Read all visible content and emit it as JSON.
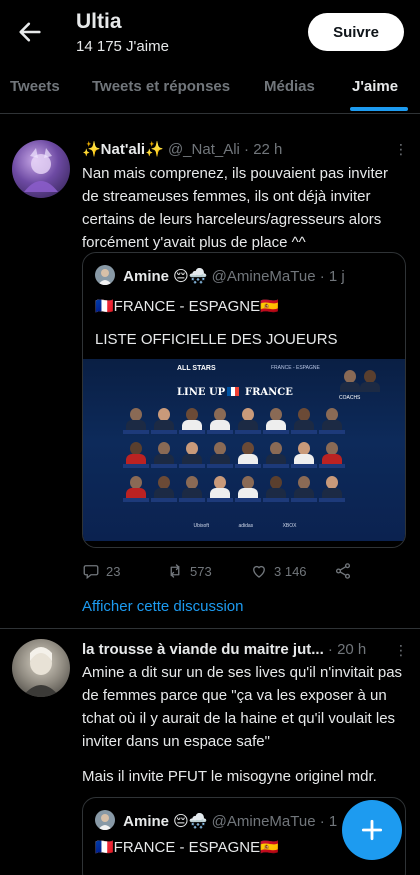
{
  "header": {
    "title": "Ultia",
    "likes_count": "14 175 J'aime",
    "follow_label": "Suivre"
  },
  "tabs": [
    {
      "label": "Tweets",
      "active": false
    },
    {
      "label": "Tweets et réponses",
      "active": false
    },
    {
      "label": "Médias",
      "active": false
    },
    {
      "label": "J'aime",
      "active": true
    }
  ],
  "tweets": [
    {
      "name": "✨Nat'ali✨",
      "handle": "@_Nat_Ali · 22 h",
      "text": "Nan mais comprenez, ils pouvaient pas inviter de streameuses femmes, ils ont déjà inviter certains de leurs harceleurs/agresseurs alors forcément y'avait plus de place ^^",
      "quote": {
        "name": "Amine 😔🌨️",
        "handle": "@AmineMaTue · 1 j",
        "line1": "🇫🇷FRANCE - ESPAGNE🇪🇸",
        "line2": "LISTE OFFICIELLE DES JOUEURS",
        "image": {
          "brand": "ALL STARS",
          "subtitle": "FRANCE - ESPAGNE",
          "line_up": "LINE UP",
          "team": "FRANCE",
          "coach_label": "COACHS",
          "sponsors": [
            "Ubisoft",
            "adidas",
            "XBOX"
          ]
        }
      },
      "stats": {
        "replies": "23",
        "retweets": "573",
        "likes": "3 146"
      },
      "show_thread": "Afficher cette discussion"
    },
    {
      "name": "la trousse à viande du maitre jut...",
      "handle": "· 20 h",
      "text": "Amine a dit sur un de ses lives qu'il n'invitait pas de femmes parce que \"ça va les exposer à un tchat où il y aurait de la haine et qu'il voulait les inviter dans un espace safe\"",
      "text2": "Mais il invite PFUT le misogyne originel mdr.",
      "quote": {
        "name": "Amine 😔🌨️",
        "handle": "@AmineMaTue · 1",
        "line1": "🇫🇷FRANCE - ESPAGNE🇪🇸"
      }
    }
  ],
  "colors": {
    "background": "#000000",
    "accent": "#1d9bf0",
    "muted": "#71767b",
    "divider": "#2f3336"
  },
  "icons": [
    "back-arrow-icon",
    "more-icon",
    "reply-icon",
    "retweet-icon",
    "like-icon",
    "share-icon",
    "compose-plus-icon"
  ]
}
